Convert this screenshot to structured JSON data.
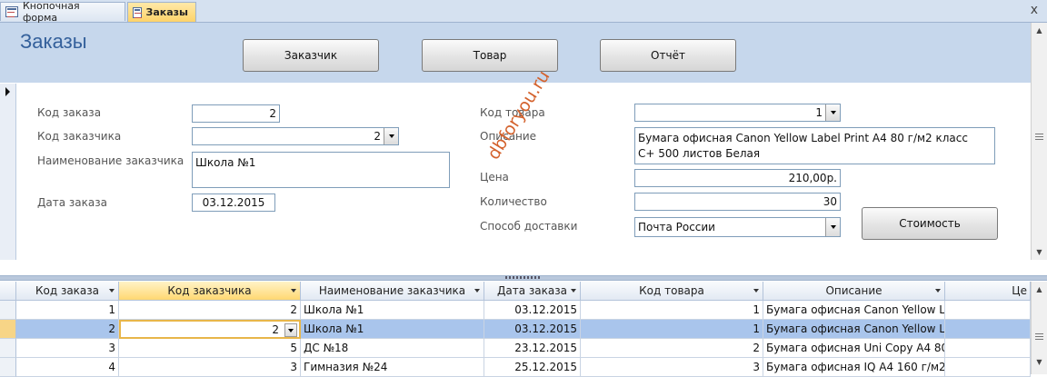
{
  "tabs": [
    {
      "label": "Кнопочная форма",
      "active": false
    },
    {
      "label": "Заказы",
      "active": true
    }
  ],
  "close_glyph": "x",
  "form": {
    "title": "Заказы",
    "buttons": {
      "customer": "Заказчик",
      "product": "Товар",
      "report": "Отчёт",
      "cost": "Стоимость"
    },
    "labels": {
      "order_id": "Код заказа",
      "customer_id": "Код заказчика",
      "customer_name": "Наименование заказчика",
      "order_date": "Дата заказа",
      "product_id": "Код товара",
      "description": "Описание",
      "price": "Цена",
      "quantity": "Количество",
      "delivery": "Способ доставки"
    },
    "values": {
      "order_id": "2",
      "customer_id": "2",
      "customer_name": "Школа №1",
      "order_date": "03.12.2015",
      "product_id": "1",
      "description_line1": "Бумага офисная Canon Yellow Label Print А4 80 г/м2 класс",
      "description_line2": "С+ 500 листов Белая",
      "price": "210,00р.",
      "quantity": "30",
      "delivery": "Почта России"
    }
  },
  "watermark": "dbforyou.ru",
  "datasheet": {
    "columns": [
      "Код заказа",
      "Код заказчика",
      "Наименование заказчика",
      "Дата заказа",
      "Код товара",
      "Описание",
      "Це"
    ],
    "active_column": "Код заказчика",
    "rows": [
      [
        "1",
        "2",
        "Школа №1",
        "03.12.2015",
        "1",
        "Бумага офисная Canon Yellow L"
      ],
      [
        "2",
        "2",
        "Школа №1",
        "03.12.2015",
        "1",
        "Бумага офисная Canon Yellow L"
      ],
      [
        "3",
        "5",
        "ДС №18",
        "23.12.2015",
        "2",
        "Бумага офисная Uni Copy А4 80"
      ],
      [
        "4",
        "3",
        "Гимназия №24",
        "25.12.2015",
        "3",
        "Бумага офисная IQ А4 160 г/м2"
      ]
    ],
    "selected_row": 1
  }
}
